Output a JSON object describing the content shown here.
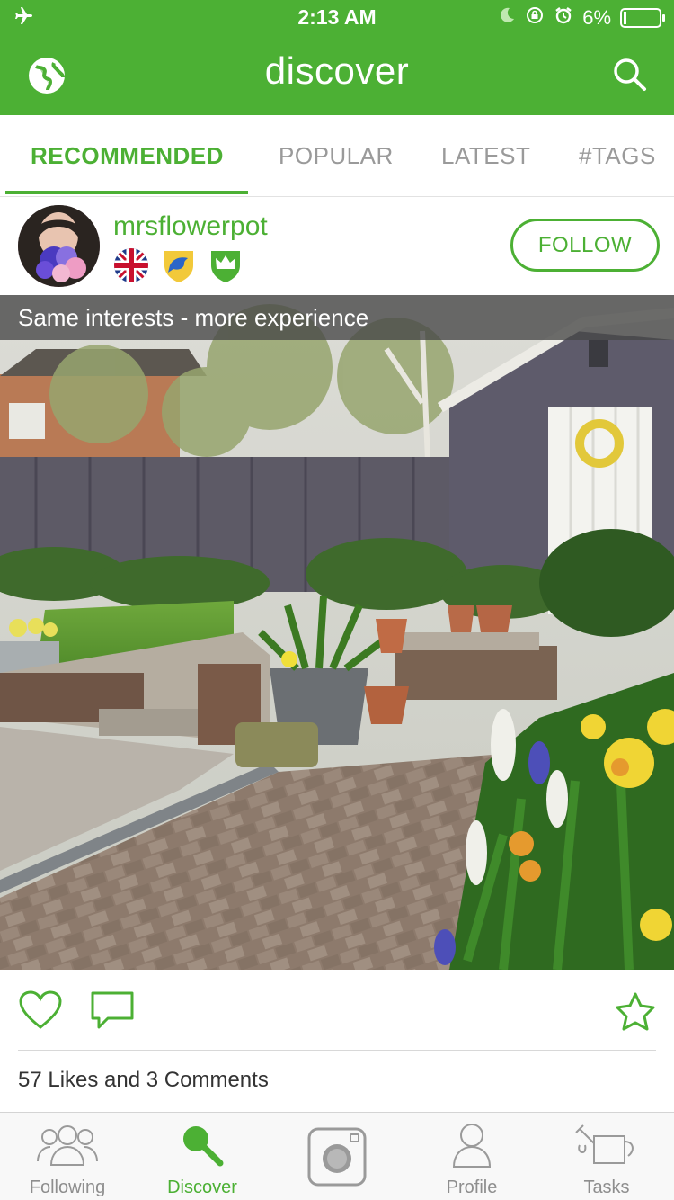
{
  "status_bar": {
    "time": "2:13 AM",
    "battery": "6%",
    "battery_level": 0.06
  },
  "header": {
    "title": "discover",
    "left_icon": "globe-icon",
    "right_icon": "search-icon"
  },
  "tabs": [
    {
      "label": "RECOMMENDED",
      "active": true
    },
    {
      "label": "POPULAR",
      "active": false
    },
    {
      "label": "LATEST",
      "active": false
    },
    {
      "label": "#TAGS",
      "active": false
    }
  ],
  "post": {
    "username": "mrsflowerpot",
    "follow_label": "FOLLOW",
    "badges": [
      "uk-flag-icon",
      "bird-shield-icon",
      "crown-shield-icon"
    ],
    "banner": "Same interests - more experience",
    "likes_text": "57 Likes and 3 Comments"
  },
  "bottom_nav": [
    {
      "label": "Following",
      "icon": "people-icon",
      "active": false
    },
    {
      "label": "Discover",
      "icon": "search-icon",
      "active": true
    },
    {
      "label": "",
      "icon": "camera-icon",
      "active": false
    },
    {
      "label": "Profile",
      "icon": "person-icon",
      "active": false
    },
    {
      "label": "Tasks",
      "icon": "watering-can-icon",
      "active": false
    }
  ],
  "colors": {
    "brand_green": "#4cb034",
    "inactive_gray": "#9a9a9a"
  }
}
